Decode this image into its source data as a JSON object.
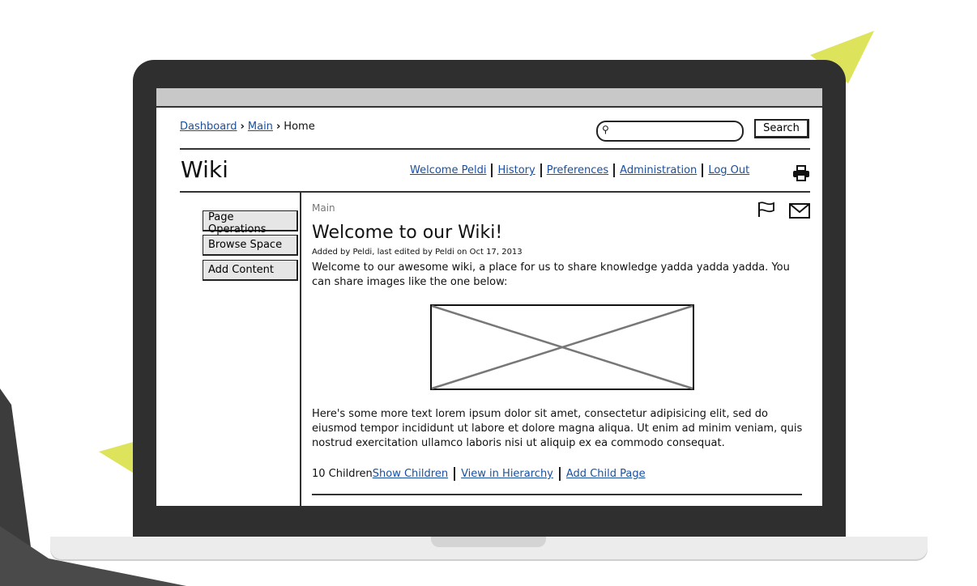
{
  "breadcrumb": [
    "Dashboard",
    "Main",
    "Home"
  ],
  "search": {
    "placeholder": "",
    "button_label": "Search"
  },
  "wiki": {
    "title": "Wiki"
  },
  "user_nav": [
    "Welcome Peldi",
    "History",
    "Preferences",
    "Administration",
    "Log Out"
  ],
  "sidebar": {
    "buttons": [
      "Page Operations",
      "Browse Space",
      "Add Content"
    ]
  },
  "page": {
    "space_label": "Main",
    "heading": "Welcome to our Wiki!",
    "meta": "Added by Peldi, last edited by Peldi on Oct 17, 2013",
    "intro": "Welcome to our awesome wiki, a place for us to share knowledge yadda yadda yadda. You can share images like the one below:",
    "body": "Here's some more text lorem ipsum dolor sit amet, consectetur adipisicing elit, sed do eiusmod tempor incididunt ut labore et dolore magna aliqua. Ut enim ad minim veniam, quis nostrud exercitation ullamco laboris nisi ut aliquip ex ea commodo consequat.",
    "children_count": "10 Children",
    "child_links": [
      "Show Children",
      "View in Hierarchy",
      "Add Child Page"
    ]
  },
  "icons": [
    "search-icon",
    "printer-icon",
    "flag-icon",
    "mail-icon",
    "image-placeholder"
  ],
  "colors": {
    "accent_yellow": "#dde35a",
    "laptop_frame": "#2f2f2f",
    "link_blue": "#1a4fa0",
    "top_bar_gray": "#c8c8c8"
  }
}
